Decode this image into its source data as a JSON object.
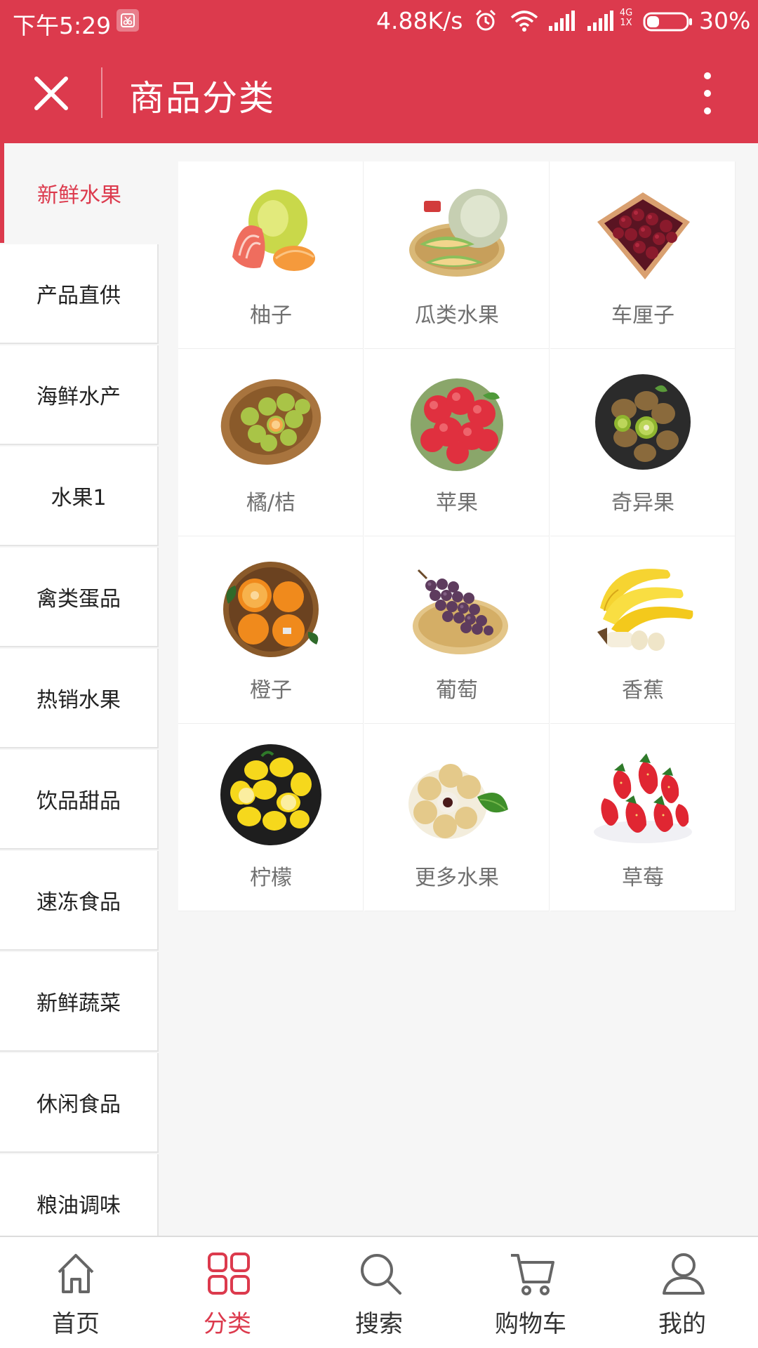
{
  "status_bar": {
    "time": "下午5:29",
    "net_speed": "4.88K/s",
    "network_top": "4G",
    "network_bottom": "1X",
    "battery_pct": "30%",
    "battery_level": 0.3
  },
  "header": {
    "title": "商品分类"
  },
  "sidebar": {
    "active_index": 0,
    "items": [
      {
        "label": "新鲜水果"
      },
      {
        "label": "产品直供"
      },
      {
        "label": "海鲜水产"
      },
      {
        "label": "水果1"
      },
      {
        "label": "禽类蛋品"
      },
      {
        "label": "热销水果"
      },
      {
        "label": "饮品甜品"
      },
      {
        "label": "速冻食品"
      },
      {
        "label": "新鲜蔬菜"
      },
      {
        "label": "休闲食品"
      },
      {
        "label": "粮油调味"
      }
    ]
  },
  "products": [
    {
      "label": "柚子",
      "icon": "pomelo-image"
    },
    {
      "label": "瓜类水果",
      "icon": "melon-image"
    },
    {
      "label": "车厘子",
      "icon": "cherries-image"
    },
    {
      "label": "橘/桔",
      "icon": "tangerines-image"
    },
    {
      "label": "苹果",
      "icon": "apples-image"
    },
    {
      "label": "奇异果",
      "icon": "kiwi-image"
    },
    {
      "label": "橙子",
      "icon": "oranges-image"
    },
    {
      "label": "葡萄",
      "icon": "grapes-image"
    },
    {
      "label": "香蕉",
      "icon": "bananas-image"
    },
    {
      "label": "柠檬",
      "icon": "lemons-image"
    },
    {
      "label": "更多水果",
      "icon": "longan-image"
    },
    {
      "label": "草莓",
      "icon": "strawberries-image"
    }
  ],
  "bottom_nav": {
    "active_index": 1,
    "items": [
      {
        "label": "首页",
        "icon": "home-icon"
      },
      {
        "label": "分类",
        "icon": "category-grid-icon"
      },
      {
        "label": "搜索",
        "icon": "search-icon"
      },
      {
        "label": "购物车",
        "icon": "cart-icon"
      },
      {
        "label": "我的",
        "icon": "user-icon"
      }
    ]
  },
  "colors": {
    "accent": "#dc3a4d",
    "background": "#f6f6f6",
    "label_gray": "#707070"
  }
}
